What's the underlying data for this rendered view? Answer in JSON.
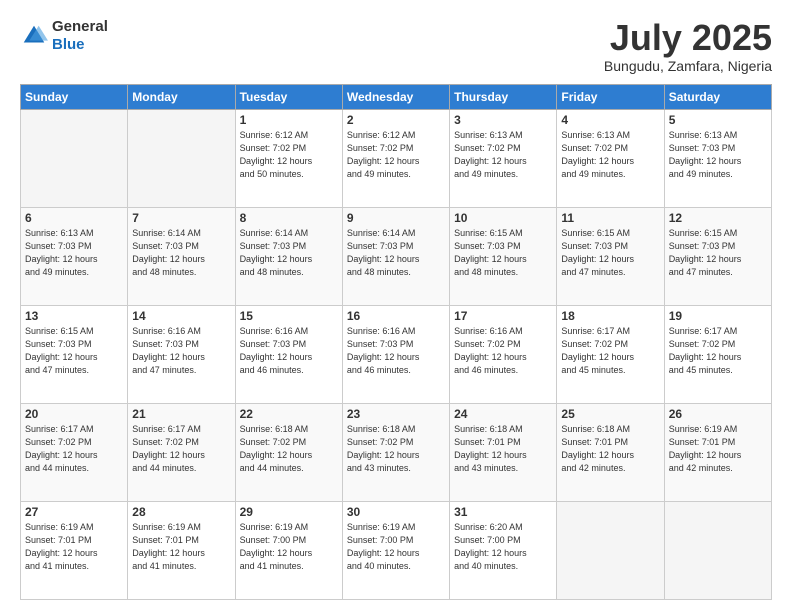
{
  "header": {
    "logo_line1": "General",
    "logo_line2": "Blue",
    "month_title": "July 2025",
    "location": "Bungudu, Zamfara, Nigeria"
  },
  "weekdays": [
    "Sunday",
    "Monday",
    "Tuesday",
    "Wednesday",
    "Thursday",
    "Friday",
    "Saturday"
  ],
  "weeks": [
    [
      {
        "day": "",
        "info": ""
      },
      {
        "day": "",
        "info": ""
      },
      {
        "day": "1",
        "info": "Sunrise: 6:12 AM\nSunset: 7:02 PM\nDaylight: 12 hours\nand 50 minutes."
      },
      {
        "day": "2",
        "info": "Sunrise: 6:12 AM\nSunset: 7:02 PM\nDaylight: 12 hours\nand 49 minutes."
      },
      {
        "day": "3",
        "info": "Sunrise: 6:13 AM\nSunset: 7:02 PM\nDaylight: 12 hours\nand 49 minutes."
      },
      {
        "day": "4",
        "info": "Sunrise: 6:13 AM\nSunset: 7:02 PM\nDaylight: 12 hours\nand 49 minutes."
      },
      {
        "day": "5",
        "info": "Sunrise: 6:13 AM\nSunset: 7:03 PM\nDaylight: 12 hours\nand 49 minutes."
      }
    ],
    [
      {
        "day": "6",
        "info": "Sunrise: 6:13 AM\nSunset: 7:03 PM\nDaylight: 12 hours\nand 49 minutes."
      },
      {
        "day": "7",
        "info": "Sunrise: 6:14 AM\nSunset: 7:03 PM\nDaylight: 12 hours\nand 48 minutes."
      },
      {
        "day": "8",
        "info": "Sunrise: 6:14 AM\nSunset: 7:03 PM\nDaylight: 12 hours\nand 48 minutes."
      },
      {
        "day": "9",
        "info": "Sunrise: 6:14 AM\nSunset: 7:03 PM\nDaylight: 12 hours\nand 48 minutes."
      },
      {
        "day": "10",
        "info": "Sunrise: 6:15 AM\nSunset: 7:03 PM\nDaylight: 12 hours\nand 48 minutes."
      },
      {
        "day": "11",
        "info": "Sunrise: 6:15 AM\nSunset: 7:03 PM\nDaylight: 12 hours\nand 47 minutes."
      },
      {
        "day": "12",
        "info": "Sunrise: 6:15 AM\nSunset: 7:03 PM\nDaylight: 12 hours\nand 47 minutes."
      }
    ],
    [
      {
        "day": "13",
        "info": "Sunrise: 6:15 AM\nSunset: 7:03 PM\nDaylight: 12 hours\nand 47 minutes."
      },
      {
        "day": "14",
        "info": "Sunrise: 6:16 AM\nSunset: 7:03 PM\nDaylight: 12 hours\nand 47 minutes."
      },
      {
        "day": "15",
        "info": "Sunrise: 6:16 AM\nSunset: 7:03 PM\nDaylight: 12 hours\nand 46 minutes."
      },
      {
        "day": "16",
        "info": "Sunrise: 6:16 AM\nSunset: 7:03 PM\nDaylight: 12 hours\nand 46 minutes."
      },
      {
        "day": "17",
        "info": "Sunrise: 6:16 AM\nSunset: 7:02 PM\nDaylight: 12 hours\nand 46 minutes."
      },
      {
        "day": "18",
        "info": "Sunrise: 6:17 AM\nSunset: 7:02 PM\nDaylight: 12 hours\nand 45 minutes."
      },
      {
        "day": "19",
        "info": "Sunrise: 6:17 AM\nSunset: 7:02 PM\nDaylight: 12 hours\nand 45 minutes."
      }
    ],
    [
      {
        "day": "20",
        "info": "Sunrise: 6:17 AM\nSunset: 7:02 PM\nDaylight: 12 hours\nand 44 minutes."
      },
      {
        "day": "21",
        "info": "Sunrise: 6:17 AM\nSunset: 7:02 PM\nDaylight: 12 hours\nand 44 minutes."
      },
      {
        "day": "22",
        "info": "Sunrise: 6:18 AM\nSunset: 7:02 PM\nDaylight: 12 hours\nand 44 minutes."
      },
      {
        "day": "23",
        "info": "Sunrise: 6:18 AM\nSunset: 7:02 PM\nDaylight: 12 hours\nand 43 minutes."
      },
      {
        "day": "24",
        "info": "Sunrise: 6:18 AM\nSunset: 7:01 PM\nDaylight: 12 hours\nand 43 minutes."
      },
      {
        "day": "25",
        "info": "Sunrise: 6:18 AM\nSunset: 7:01 PM\nDaylight: 12 hours\nand 42 minutes."
      },
      {
        "day": "26",
        "info": "Sunrise: 6:19 AM\nSunset: 7:01 PM\nDaylight: 12 hours\nand 42 minutes."
      }
    ],
    [
      {
        "day": "27",
        "info": "Sunrise: 6:19 AM\nSunset: 7:01 PM\nDaylight: 12 hours\nand 41 minutes."
      },
      {
        "day": "28",
        "info": "Sunrise: 6:19 AM\nSunset: 7:01 PM\nDaylight: 12 hours\nand 41 minutes."
      },
      {
        "day": "29",
        "info": "Sunrise: 6:19 AM\nSunset: 7:00 PM\nDaylight: 12 hours\nand 41 minutes."
      },
      {
        "day": "30",
        "info": "Sunrise: 6:19 AM\nSunset: 7:00 PM\nDaylight: 12 hours\nand 40 minutes."
      },
      {
        "day": "31",
        "info": "Sunrise: 6:20 AM\nSunset: 7:00 PM\nDaylight: 12 hours\nand 40 minutes."
      },
      {
        "day": "",
        "info": ""
      },
      {
        "day": "",
        "info": ""
      }
    ]
  ]
}
